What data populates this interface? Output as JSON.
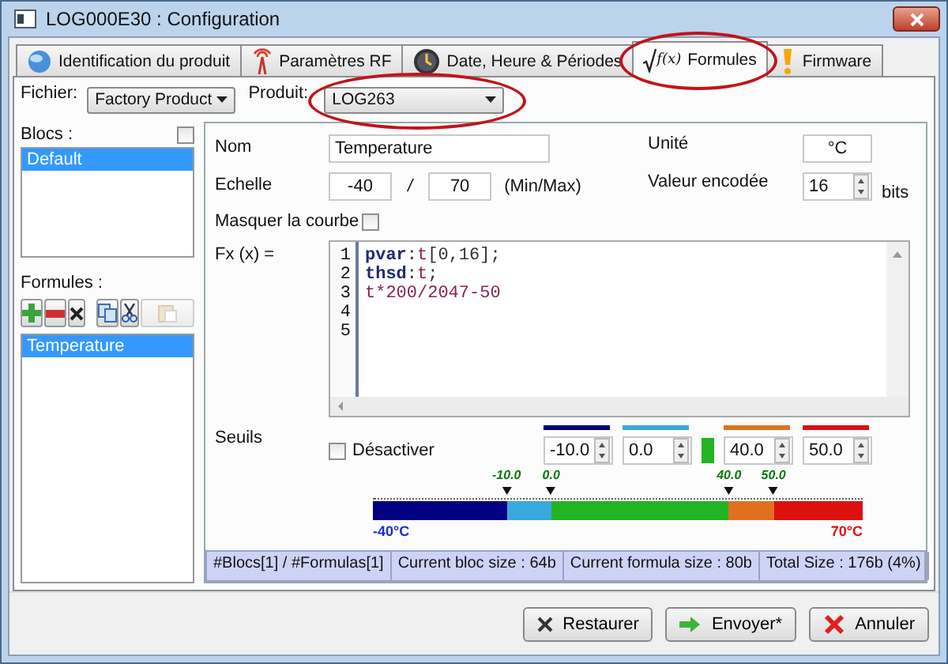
{
  "window": {
    "title": "LOG000E30 : Configuration"
  },
  "tabs": [
    {
      "label": "Identification du produit",
      "selected": false,
      "highlighted": false
    },
    {
      "label": "Paramètres RF",
      "selected": false,
      "highlighted": false
    },
    {
      "label": "Date, Heure & Périodes",
      "selected": false,
      "highlighted": false
    },
    {
      "label": "Formules",
      "symbol": "f(x)",
      "selected": true,
      "highlighted": true
    },
    {
      "label": "Firmware",
      "selected": false,
      "highlighted": false
    }
  ],
  "file": {
    "label": "Fichier:",
    "value": "Factory Product"
  },
  "product": {
    "label": "Produit:",
    "value": "LOG263",
    "highlighted": true
  },
  "blocs": {
    "label": "Blocs :",
    "checked": false,
    "items": [
      {
        "label": "Default",
        "selected": true
      }
    ]
  },
  "formulas": {
    "label": "Formules :",
    "toolbar": [
      {
        "kind": "add",
        "disabled": false
      },
      {
        "kind": "remove",
        "disabled": false
      },
      {
        "kind": "delete",
        "disabled": false
      },
      {
        "kind": "copy",
        "disabled": false
      },
      {
        "kind": "cut",
        "disabled": false
      },
      {
        "kind": "paste",
        "disabled": true
      }
    ],
    "items": [
      {
        "label": "Temperature",
        "selected": true
      }
    ]
  },
  "form": {
    "name_label": "Nom",
    "name_value": "Temperature",
    "unit_label": "Unité",
    "unit_value": "°C",
    "scale_label": "Echelle",
    "min_value": "-40",
    "separator": "/",
    "max_value": "70",
    "minmax_hint": "(Min/Max)",
    "encoded_label": "Valeur encodée",
    "encoded_value": "16",
    "encoded_unit": "bits",
    "hide_curve_label": "Masquer la courbe",
    "hide_curve_checked": false,
    "fx_label": "Fx (x) ="
  },
  "editor": {
    "lines": [
      {
        "number": "1",
        "tokens": [
          {
            "text": "pvar",
            "kind": "keyword"
          },
          {
            "text": ":",
            "kind": "plain"
          },
          {
            "text": "t",
            "kind": "variable"
          },
          {
            "text": "[0,16];",
            "kind": "plain"
          }
        ]
      },
      {
        "number": "2",
        "tokens": [
          {
            "text": "thsd",
            "kind": "keyword"
          },
          {
            "text": ":",
            "kind": "plain"
          },
          {
            "text": "t",
            "kind": "variable"
          },
          {
            "text": ";",
            "kind": "plain"
          }
        ]
      },
      {
        "number": "3",
        "tokens": [
          {
            "text": "t*200/2047-50",
            "kind": "variable"
          }
        ]
      },
      {
        "number": "4"
      },
      {
        "number": "5"
      }
    ]
  },
  "thresholds": {
    "label": "Seuils",
    "disable_label": "Désactiver",
    "disable_checked": false,
    "fields": [
      {
        "value": "-10.0",
        "color": "#000080"
      },
      {
        "value": "0.0",
        "color": "#3aa8dc"
      },
      {
        "value": "40.0",
        "color": "#e07020"
      },
      {
        "value": "50.0",
        "color": "#dd1010"
      }
    ]
  },
  "scale": {
    "min_label": "-40°C",
    "max_label": "70°C",
    "markers": [
      {
        "label": "-10.0",
        "level": 0.273
      },
      {
        "label": "0.0",
        "level": 0.364
      },
      {
        "label": "40.0",
        "level": 0.727
      },
      {
        "label": "50.0",
        "level": 0.818
      }
    ],
    "segments": [
      {
        "color": "#000080"
      },
      {
        "color": "#3aa8dc"
      },
      {
        "color": "#22b422"
      },
      {
        "color": "#e07020"
      },
      {
        "color": "#dd1010"
      }
    ]
  },
  "status_bar": [
    "#Blocs[1] / #Formulas[1]",
    "Current bloc size : 64b",
    "Current formula size : 80b",
    "Total Size : 176b (4%)"
  ],
  "buttons": [
    {
      "label": "Restaurer"
    },
    {
      "label": "Envoyer*"
    },
    {
      "label": "Annuler"
    }
  ]
}
